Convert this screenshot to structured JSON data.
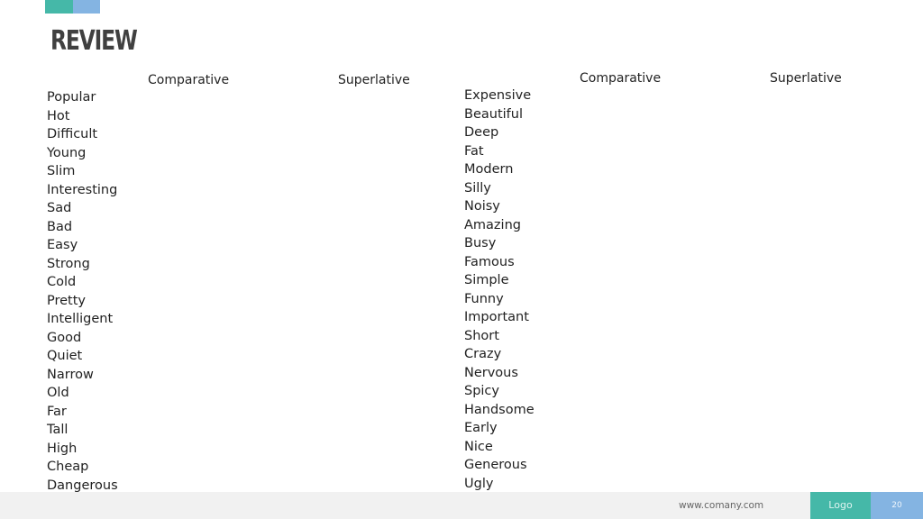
{
  "slide": {
    "title": "REVIEW",
    "colors": {
      "accent_teal": "#45b8a8",
      "accent_blue": "#84b4e2",
      "text": "#222222",
      "footer_bg": "#f1f1f1"
    }
  },
  "left_table": {
    "headers": {
      "comparative": "Comparative",
      "superlative": "Superlative"
    },
    "words": [
      "Popular",
      "Hot",
      "Difficult",
      "Young",
      "Slim",
      "Interesting",
      "Sad",
      "Bad",
      "Easy",
      "Strong",
      "Cold",
      "Pretty",
      "Intelligent",
      "Good",
      "Quiet",
      "Narrow",
      "Old",
      "Far",
      "Tall",
      "High",
      "Cheap",
      "Dangerous"
    ]
  },
  "right_table": {
    "headers": {
      "comparative": "Comparative",
      "superlative": "Superlative"
    },
    "words": [
      "Expensive",
      "Beautiful",
      "Deep",
      "Fat",
      "Modern",
      "Silly",
      "Noisy",
      "Amazing",
      "Busy",
      "Famous",
      "Simple",
      "Funny",
      "Important",
      "Short",
      "Crazy",
      "Nervous",
      "Spicy",
      "Handsome",
      "Early",
      "Nice",
      "Generous",
      "Ugly"
    ]
  },
  "footer": {
    "url": "www.comany.com",
    "logo": "Logo",
    "page_number": "20"
  }
}
